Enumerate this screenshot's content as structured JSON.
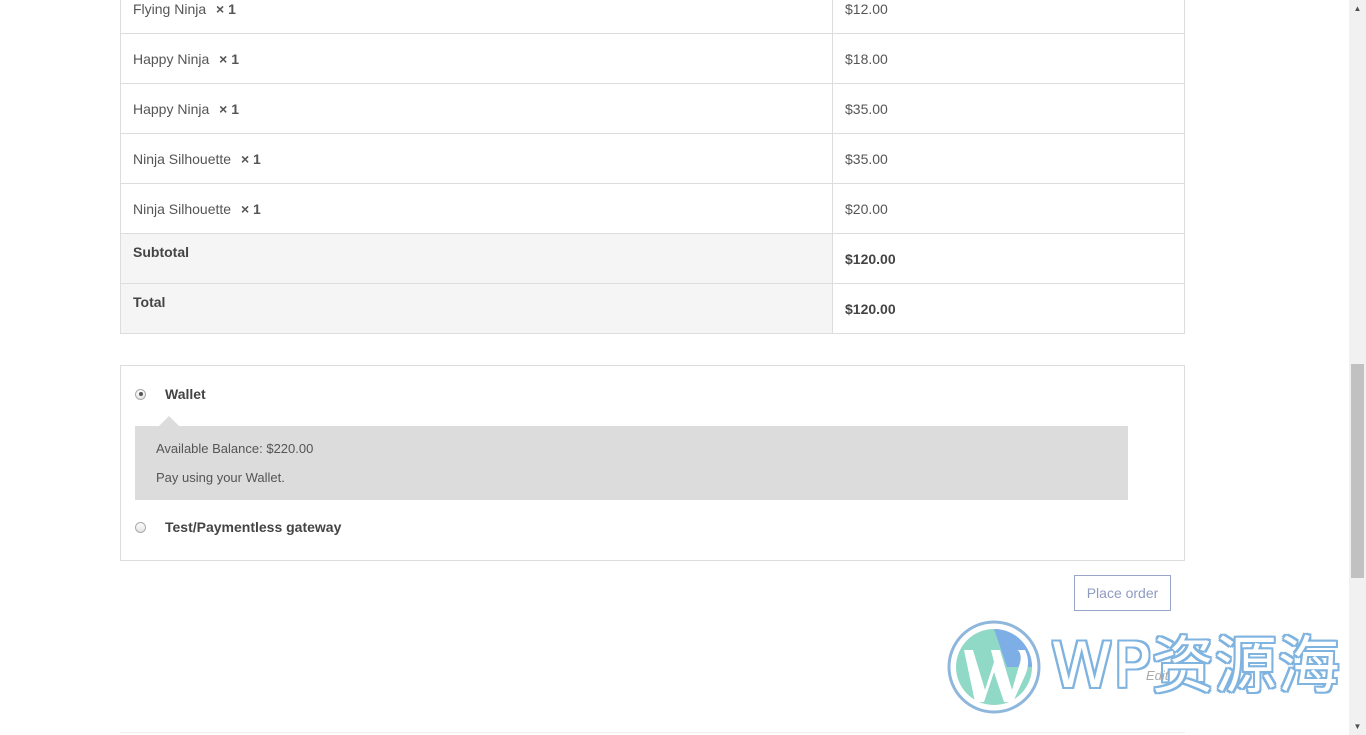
{
  "order_review": {
    "items": [
      {
        "name": "Flying Ninja",
        "qty": "× 1",
        "price": "$12.00"
      },
      {
        "name": "Happy Ninja",
        "qty": "× 1",
        "price": "$18.00"
      },
      {
        "name": "Happy Ninja",
        "qty": "× 1",
        "price": "$35.00"
      },
      {
        "name": "Ninja Silhouette",
        "qty": "× 1",
        "price": "$35.00"
      },
      {
        "name": "Ninja Silhouette",
        "qty": "× 1",
        "price": "$20.00"
      }
    ],
    "subtotal": {
      "label": "Subtotal",
      "value": "$120.00"
    },
    "total": {
      "label": "Total",
      "value": "$120.00"
    }
  },
  "payment": {
    "methods": [
      {
        "label": "Wallet",
        "selected": true
      },
      {
        "label": "Test/Paymentless gateway",
        "selected": false
      }
    ],
    "wallet_description": {
      "balance": "Available Balance: $220.00",
      "note": "Pay using your Wallet."
    }
  },
  "place_order_label": "Place order",
  "edit_link": "Edit",
  "watermark": {
    "text": "WP资源海",
    "icon": "wordpress-logo-icon"
  },
  "scrollbar": {
    "up_icon": "▲",
    "down_icon": "▼"
  },
  "colors": {
    "button_border": "#9aa6c9",
    "description_bg": "#dddcdd",
    "summary_bg": "#f5f5f5"
  }
}
